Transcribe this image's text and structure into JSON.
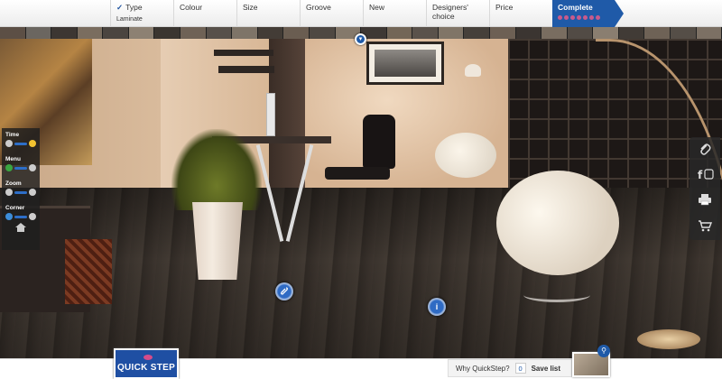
{
  "steps": [
    {
      "label": "Type",
      "sub": "Laminate",
      "checked": true
    },
    {
      "label": "Colour",
      "sub": ""
    },
    {
      "label": "Size",
      "sub": ""
    },
    {
      "label": "Groove",
      "sub": ""
    },
    {
      "label": "New",
      "sub": ""
    },
    {
      "label": "Designers' choice",
      "sub": ""
    },
    {
      "label": "Price",
      "sub": ""
    },
    {
      "label": "Complete",
      "sub": "",
      "active": true
    }
  ],
  "check_mark": "✓",
  "controls": {
    "time_label": "Time",
    "menu_label": "Menu",
    "zoom_label": "Zoom",
    "corner_label": "Corner"
  },
  "tools": [
    "paperclip-icon",
    "facebook-twitter-icon",
    "print-icon",
    "cart-icon"
  ],
  "hotspots": {
    "paperclip_symbol": "⌀",
    "info_symbol": "i"
  },
  "bottom": {
    "logo_text": "QUICK STEP",
    "why_label": "Why QuickStep?",
    "save_count": "0",
    "save_label": "Save list"
  },
  "colors": {
    "brand_blue": "#1f5aa8",
    "brand_pink": "#d64b8a"
  }
}
